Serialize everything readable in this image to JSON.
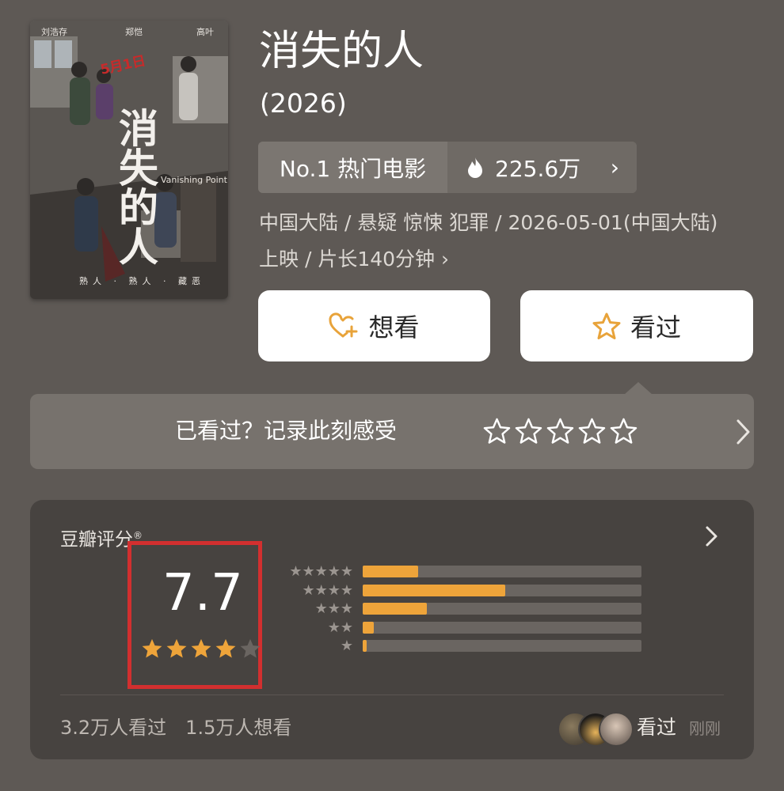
{
  "poster": {
    "cast": [
      "刘浩存",
      "郑恺",
      "高叶"
    ],
    "date_text": "5月1日",
    "title_text": "消失的人",
    "english_title": "Vanishing Point",
    "tagline": "熟人 · 熟人 · 藏恶"
  },
  "movie": {
    "title": "消失的人",
    "year": "(2026)"
  },
  "ranking": {
    "label": "No.1 热门电影",
    "hot_count": "225.6万",
    "chevron": "›"
  },
  "meta": {
    "line1": "中国大陆 / 悬疑 惊悚 犯罪 / 2026-05-01(中国大陆)",
    "line2": "上映 / 片长140分钟 ›"
  },
  "actions": {
    "want_label": "想看",
    "seen_label": "看过"
  },
  "record": {
    "label": "已看过？记录此刻感受",
    "chevron": "›"
  },
  "rating": {
    "header": "豆瓣评分",
    "registered_mark": "®",
    "score": "7.7",
    "score_stars": 4,
    "distribution": [
      {
        "stars_text": "★★★★★",
        "value": 20
      },
      {
        "stars_text": "★★★★",
        "value": 51
      },
      {
        "stars_text": "★★★",
        "value": 23
      },
      {
        "stars_text": "★★",
        "value": 4
      },
      {
        "stars_text": "★",
        "value": 1.5
      }
    ],
    "seen_count": "3.2万人看过",
    "want_count": "1.5万人想看",
    "recent_label": "看过",
    "recent_time": "刚刚"
  },
  "colors": {
    "accent": "#eea43a",
    "highlight_box": "#d22f2f",
    "background": "#5e5955"
  },
  "icons": {
    "hot": "fire-icon",
    "want": "heart-plus-icon",
    "seen": "star-outline-icon"
  }
}
